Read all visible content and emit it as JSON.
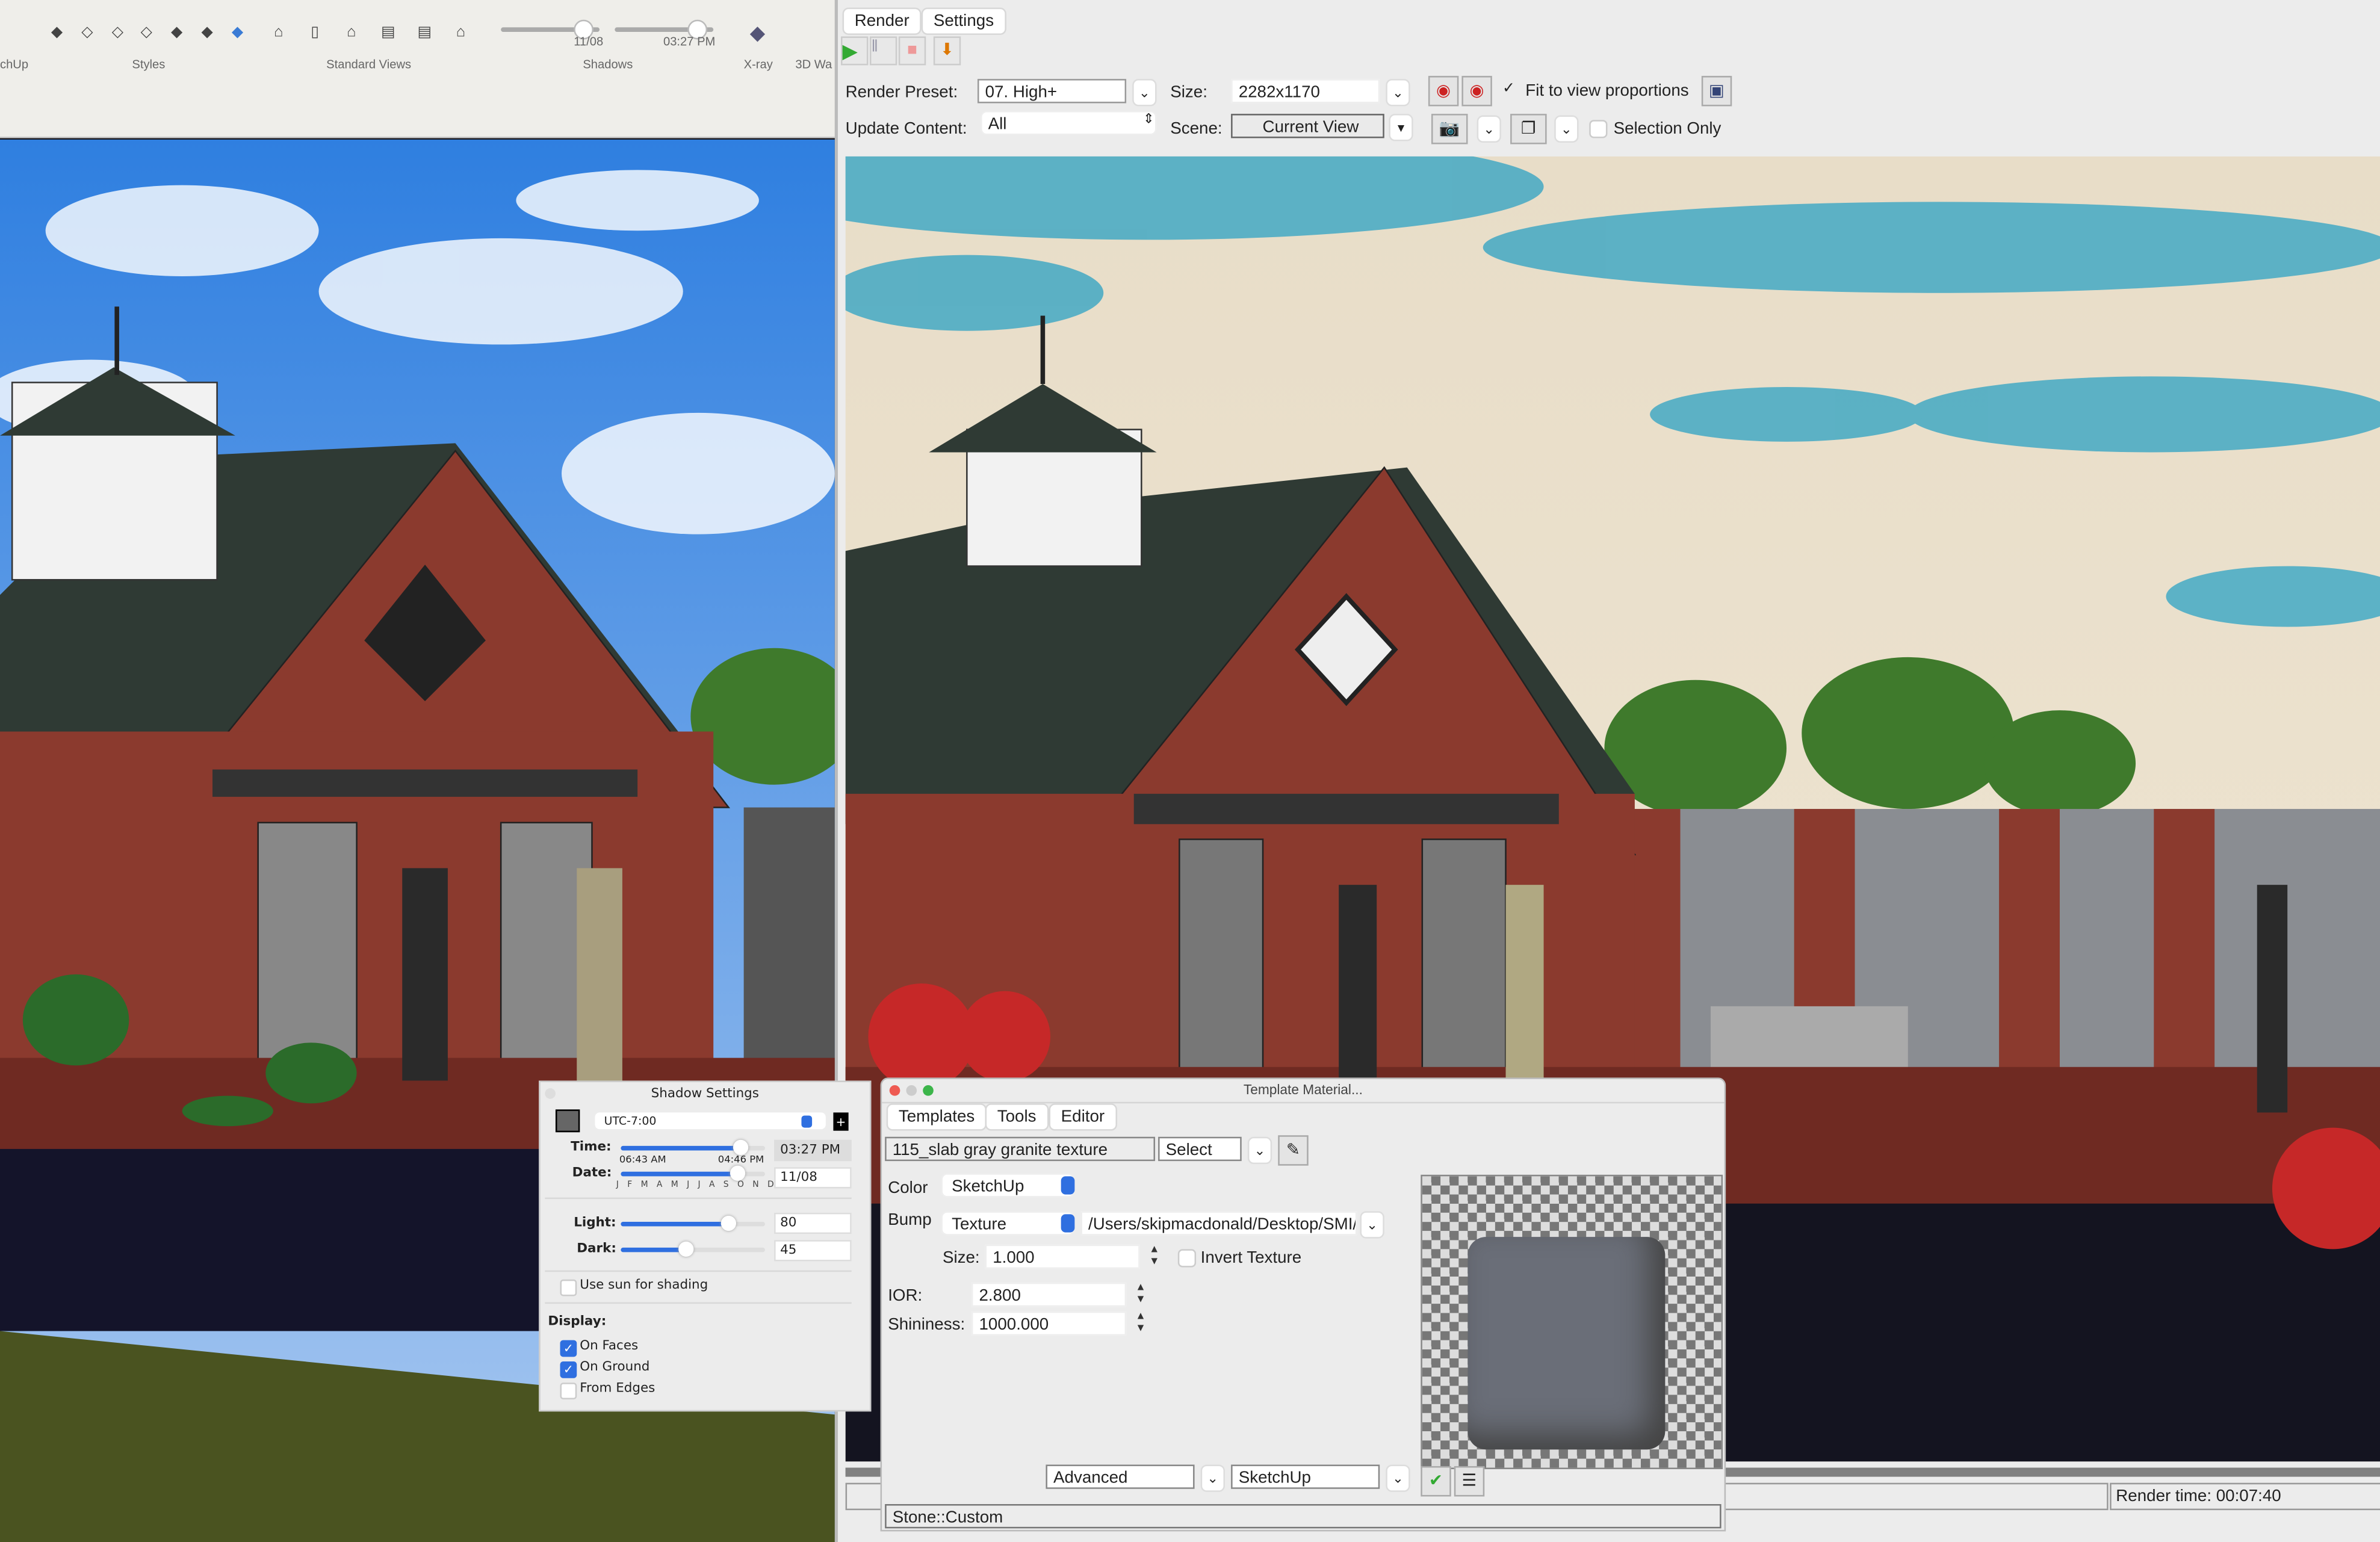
{
  "sketchup_toolbar": {
    "groups": [
      {
        "label": "chUp"
      },
      {
        "label": "Styles",
        "icons": [
          "xray-style-icon",
          "back-edges-style-icon",
          "wireframe-style-icon",
          "hidden-line-style-icon",
          "shaded-style-icon",
          "shaded-textures-style-icon",
          "monochrome-style-icon"
        ]
      },
      {
        "label": "Standard Views",
        "icons": [
          "iso-view-icon",
          "top-view-icon",
          "front-view-icon",
          "right-view-icon",
          "back-view-icon",
          "left-view-icon"
        ]
      },
      {
        "label": "Shadows",
        "date": "11/08",
        "time": "03:27 PM",
        "date_fraction": 0.85,
        "time_fraction": 0.82
      },
      {
        "label": "X-ray"
      },
      {
        "label": "3D Wa"
      }
    ]
  },
  "render_window": {
    "tabs": [
      "Render",
      "Settings"
    ],
    "toolbar_icons": [
      "play-icon",
      "pause-icon",
      "stop-icon",
      "save-render-icon"
    ],
    "render_preset_label": "Render Preset:",
    "render_preset_value": "07. High+",
    "size_label": "Size:",
    "size_value": "2282x1170",
    "fit_to_view_label": "Fit to view proportions",
    "fit_to_view_checked": true,
    "update_content_label": "Update Content:",
    "update_content_value": "All",
    "scene_label": "Scene:",
    "scene_value": "Current View",
    "selection_only_label": "Selection Only",
    "selection_only_checked": false,
    "progress": 1.0,
    "render_time": "Render time: 00:07:40"
  },
  "shadow_settings": {
    "title": "Shadow Settings",
    "timezone": "UTC-7:00",
    "time_label": "Time:",
    "time_value": "03:27 PM",
    "time_fraction": 0.8,
    "sunrise": "06:43 AM",
    "sunset": "04:46 PM",
    "date_label": "Date:",
    "date_value": "11/08",
    "date_fraction": 0.78,
    "months": [
      "J",
      "F",
      "M",
      "A",
      "M",
      "J",
      "J",
      "A",
      "S",
      "O",
      "N",
      "D"
    ],
    "light_label": "Light:",
    "light_value": "80",
    "dark_label": "Dark:",
    "dark_value": "45",
    "use_sun_label": "Use sun for shading",
    "use_sun_checked": false,
    "display_label": "Display:",
    "display_options": [
      {
        "label": "On Faces",
        "checked": true
      },
      {
        "label": "On Ground",
        "checked": true
      },
      {
        "label": "From Edges",
        "checked": false
      }
    ]
  },
  "template_material": {
    "title": "Template Material...",
    "tabs": [
      "Templates",
      "Tools",
      "Editor"
    ],
    "material_name": "115_slab gray granite texture",
    "select_label": "Select",
    "color_label": "Color",
    "color_value": "SketchUp",
    "bump_label": "Bump",
    "bump_value": "Texture",
    "bump_path": "/Users/skipmacdonald/Desktop/SMI/S K",
    "size_label": "Size:",
    "size_value": "1.000",
    "invert_texture_label": "Invert Texture",
    "invert_texture_checked": false,
    "ior_label": "IOR:",
    "ior_value": "2.800",
    "shininess_label": "Shininess:",
    "shininess_value": "1000.000",
    "mode_value": "Advanced",
    "engine_value": "SketchUp",
    "status": "Stone::Custom"
  },
  "colors": {
    "accent_blue": "#2f6fe0",
    "sky": "#4a90d9",
    "brick": "#8b3a2e",
    "roof": "#2f3a34"
  }
}
